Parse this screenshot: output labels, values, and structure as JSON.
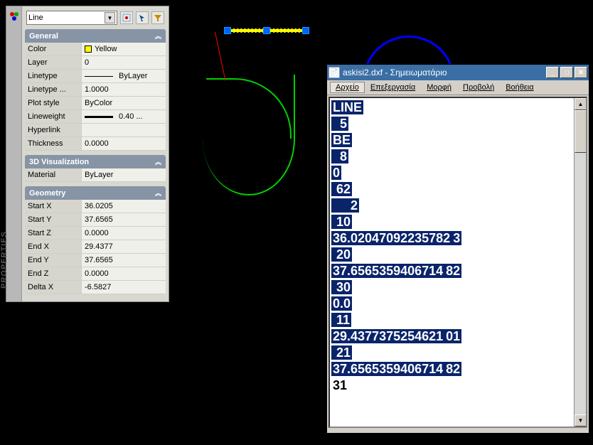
{
  "entity_combo": "Line",
  "sections": {
    "general": {
      "title": "General",
      "rows": {
        "color_lbl": "Color",
        "color_val": "Yellow",
        "color_hex": "#ffff00",
        "layer_lbl": "Layer",
        "layer_val": "0",
        "linetype_lbl": "Linetype",
        "linetype_val": "ByLayer",
        "ltscale_lbl": "Linetype ...",
        "ltscale_val": "1.0000",
        "plot_lbl": "Plot style",
        "plot_val": "ByColor",
        "lw_lbl": "Lineweight",
        "lw_val": "0.40 ...",
        "hlink_lbl": "Hyperlink",
        "hlink_val": "",
        "thick_lbl": "Thickness",
        "thick_val": "0.0000"
      }
    },
    "viz": {
      "title": "3D Visualization",
      "rows": {
        "mat_lbl": "Material",
        "mat_val": "ByLayer"
      }
    },
    "geom": {
      "title": "Geometry",
      "rows": {
        "sx_lbl": "Start X",
        "sx_val": "36.0205",
        "sy_lbl": "Start Y",
        "sy_val": "37.6565",
        "sz_lbl": "Start Z",
        "sz_val": "0.0000",
        "ex_lbl": "End X",
        "ex_val": "29.4377",
        "ey_lbl": "End Y",
        "ey_val": "37.6565",
        "ez_lbl": "End Z",
        "ez_val": "0.0000",
        "dx_lbl": "Delta X",
        "dx_val": "-6.5827"
      }
    }
  },
  "side_label": "PROPERTIES",
  "notepad": {
    "title": "askisi2.dxf - Σημειωματάριο",
    "menu": [
      "Αρχείο",
      "Επεξεργασία",
      "Μορφή",
      "Προβολή",
      "Βοήθεια"
    ],
    "lines_sel": [
      "LINE",
      "  5",
      "BE",
      "  8",
      "0",
      " 62",
      "     2",
      " 10",
      "36.02047092235782",
      "3",
      " 20",
      "37.6565359406714",
      "82",
      " 30",
      "0.0",
      " 11",
      "29.4377375254621",
      "01",
      " 21",
      "37.6565359406714",
      "82"
    ],
    "line_plain": " 31"
  }
}
